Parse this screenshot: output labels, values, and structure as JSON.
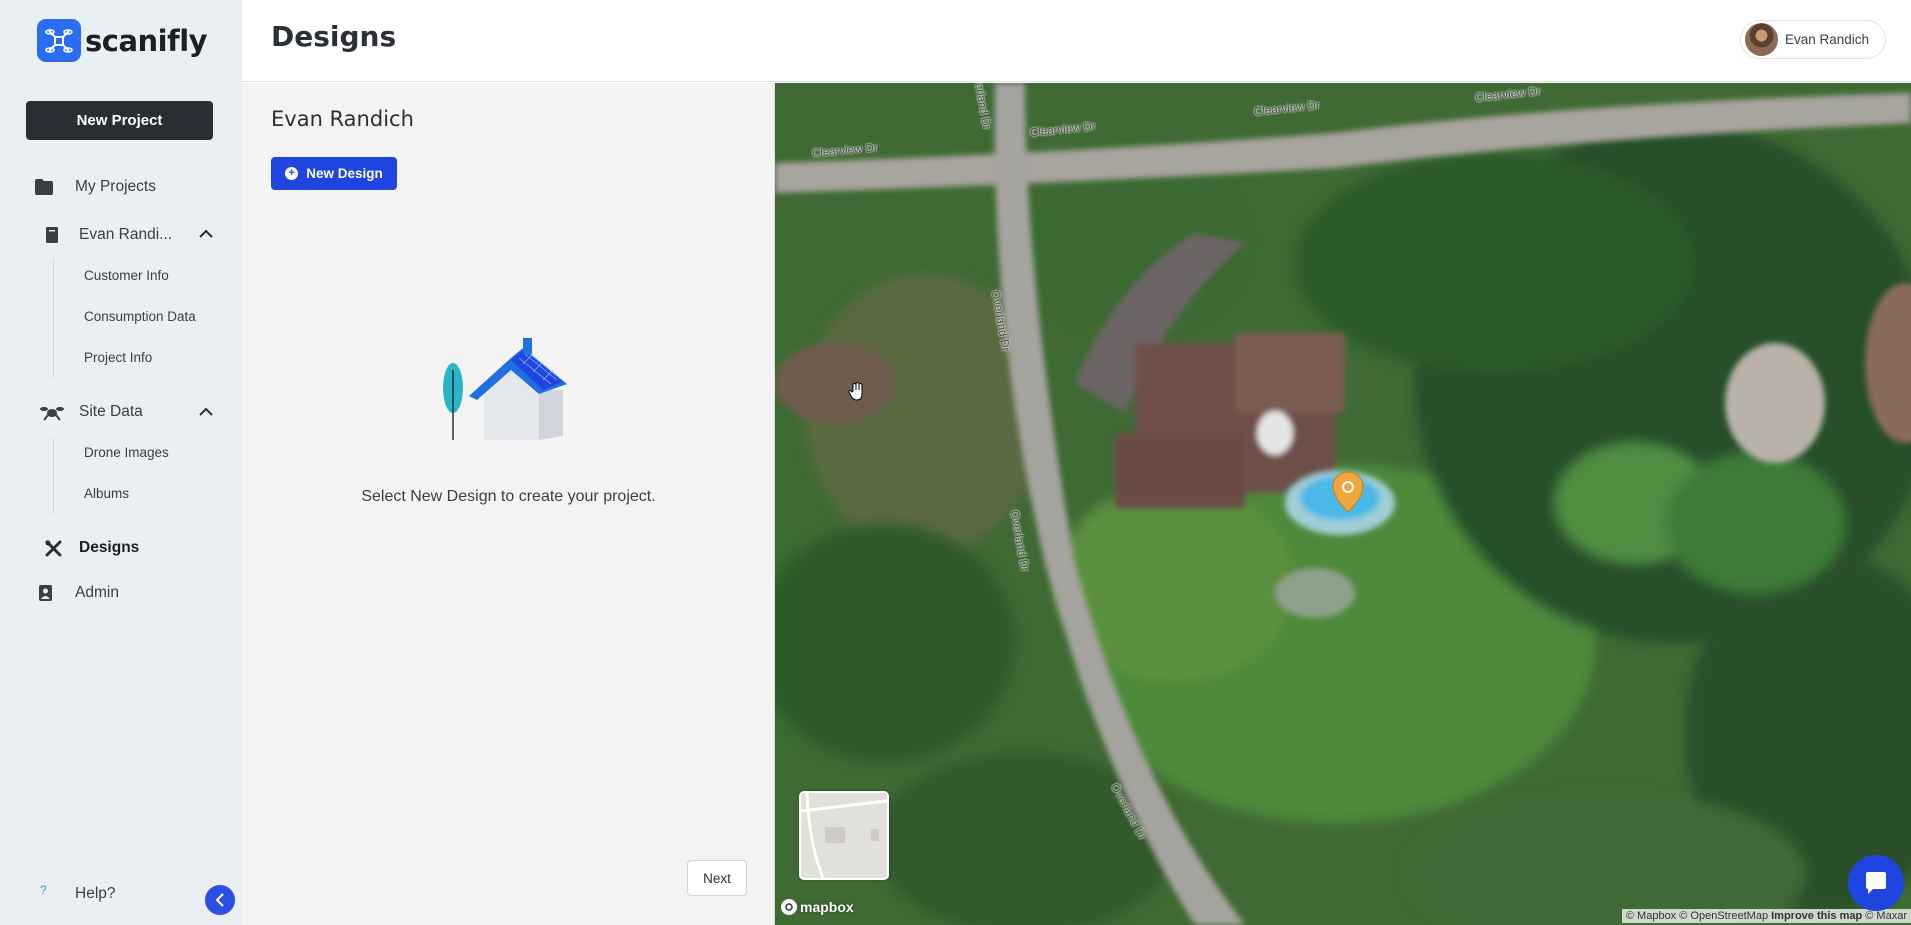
{
  "app": {
    "logo_text": "scanifly",
    "brand_color": "#2a6cf2",
    "accent_color": "#1f45e0"
  },
  "sidebar": {
    "new_project_label": "New Project",
    "my_projects_label": "My Projects",
    "project_group": {
      "label": "Evan Randi...",
      "expanded": true,
      "items": [
        {
          "label": "Customer Info"
        },
        {
          "label": "Consumption Data"
        },
        {
          "label": "Project Info"
        }
      ]
    },
    "site_data_group": {
      "label": "Site Data",
      "expanded": true,
      "items": [
        {
          "label": "Drone Images"
        },
        {
          "label": "Albums"
        }
      ]
    },
    "designs_label": "Designs",
    "admin_label": "Admin",
    "help_label": "Help?",
    "help_icon": "?"
  },
  "header": {
    "title": "Designs",
    "user_name": "Evan Randich"
  },
  "panel": {
    "project_name": "Evan Randich",
    "new_design_label": "New Design",
    "empty_message": "Select New Design to create your project.",
    "next_label": "Next"
  },
  "map": {
    "roads": [
      {
        "label": "Clearview Dr"
      },
      {
        "label": "Clearview Dr"
      },
      {
        "label": "Clearview Dr"
      },
      {
        "label": "Clearview Dr"
      },
      {
        "label": "Overland Dr"
      },
      {
        "label": "Overland Dr"
      },
      {
        "label": "Overland Dr"
      },
      {
        "label": "Overland Dr"
      }
    ],
    "logo_text": "mapbox",
    "attribution": "© Mapbox © OpenStreetMap",
    "improve_link": "Improve this map",
    "attribution_tail": "© Maxar"
  }
}
